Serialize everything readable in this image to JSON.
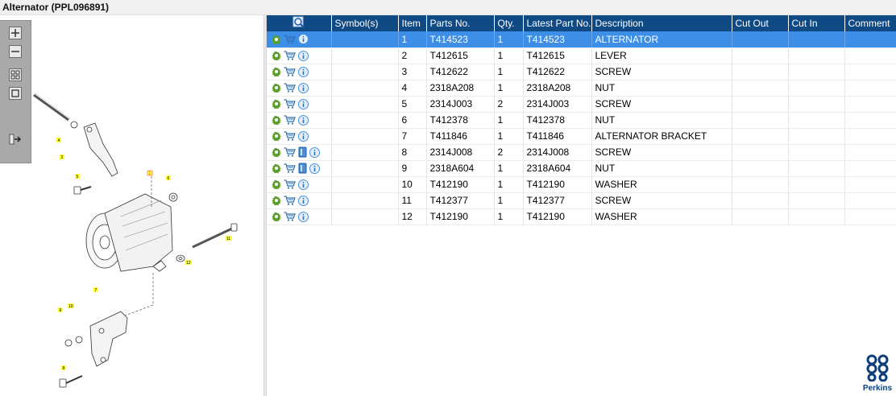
{
  "window": {
    "title": "Alternator (PPL096891)"
  },
  "toolbar": {
    "buttons": [
      {
        "name": "zoom-in",
        "icon": "plus-icon"
      },
      {
        "name": "zoom-out",
        "icon": "minus-icon"
      },
      {
        "name": "fit-view",
        "icon": "grid-icon"
      },
      {
        "name": "actual-size",
        "icon": "square-icon"
      },
      {
        "name": "export",
        "icon": "export-arrow-icon"
      }
    ]
  },
  "diagram": {
    "callouts": [
      "1",
      "2",
      "4",
      "5",
      "6",
      "7",
      "8",
      "9",
      "10",
      "11",
      "12"
    ]
  },
  "table": {
    "columns": {
      "symbols": "Symbol(s)",
      "item": "Item",
      "parts_no": "Parts No.",
      "qty": "Qty.",
      "latest": "Latest Part No.",
      "description": "Description",
      "cut_out": "Cut Out",
      "cut_in": "Cut In",
      "comment": "Comment"
    },
    "rows": [
      {
        "item": "1",
        "parts_no": "T414523",
        "qty": "1",
        "latest": "T414523",
        "description": "ALTERNATOR",
        "book": false
      },
      {
        "item": "2",
        "parts_no": "T412615",
        "qty": "1",
        "latest": "T412615",
        "description": "LEVER",
        "book": false
      },
      {
        "item": "3",
        "parts_no": "T412622",
        "qty": "1",
        "latest": "T412622",
        "description": "SCREW",
        "book": false
      },
      {
        "item": "4",
        "parts_no": "2318A208",
        "qty": "1",
        "latest": "2318A208",
        "description": "NUT",
        "book": false
      },
      {
        "item": "5",
        "parts_no": "2314J003",
        "qty": "2",
        "latest": "2314J003",
        "description": "SCREW",
        "book": false
      },
      {
        "item": "6",
        "parts_no": "T412378",
        "qty": "1",
        "latest": "T412378",
        "description": "NUT",
        "book": false
      },
      {
        "item": "7",
        "parts_no": "T411846",
        "qty": "1",
        "latest": "T411846",
        "description": "ALTERNATOR BRACKET",
        "book": false
      },
      {
        "item": "8",
        "parts_no": "2314J008",
        "qty": "2",
        "latest": "2314J008",
        "description": "SCREW",
        "book": true
      },
      {
        "item": "9",
        "parts_no": "2318A604",
        "qty": "1",
        "latest": "2318A604",
        "description": "NUT",
        "book": true
      },
      {
        "item": "10",
        "parts_no": "T412190",
        "qty": "1",
        "latest": "T412190",
        "description": "WASHER",
        "book": false
      },
      {
        "item": "11",
        "parts_no": "T412377",
        "qty": "1",
        "latest": "T412377",
        "description": "SCREW",
        "book": false
      },
      {
        "item": "12",
        "parts_no": "T412190",
        "qty": "1",
        "latest": "T412190",
        "description": "WASHER",
        "book": false
      }
    ],
    "selected_index": 0
  },
  "colors": {
    "header": "#0f4a84",
    "selected_row": "#3d8ee6",
    "gear": "#5aa02c",
    "cart": "#2f6fb5",
    "info": "#4a90d9",
    "callout": "#ffff3c"
  },
  "brand": {
    "name": "Perkins"
  }
}
